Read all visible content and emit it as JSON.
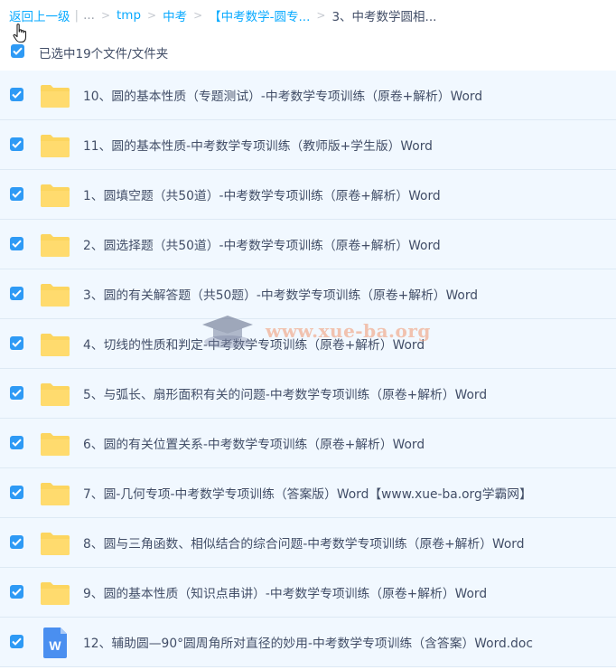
{
  "breadcrumb": {
    "back": "返回上一级",
    "ellipsis": "...",
    "items": [
      "tmp",
      "中考",
      "【中考数学-圆专...",
      "3、中考数学圆相..."
    ]
  },
  "selection": {
    "text": "已选中19个文件/文件夹",
    "checked": true
  },
  "files": [
    {
      "name": "10、圆的基本性质（专题测试）-中考数学专项训练（原卷+解析）Word",
      "type": "folder",
      "checked": true
    },
    {
      "name": "11、圆的基本性质-中考数学专项训练（教师版+学生版）Word",
      "type": "folder",
      "checked": true
    },
    {
      "name": "1、圆填空题（共50道）-中考数学专项训练（原卷+解析）Word",
      "type": "folder",
      "checked": true
    },
    {
      "name": "2、圆选择题（共50道）-中考数学专项训练（原卷+解析）Word",
      "type": "folder",
      "checked": true
    },
    {
      "name": "3、圆的有关解答题（共50题）-中考数学专项训练（原卷+解析）Word",
      "type": "folder",
      "checked": true
    },
    {
      "name": "4、切线的性质和判定-中考数学专项训练（原卷+解析）Word",
      "type": "folder",
      "checked": true
    },
    {
      "name": "5、与弧长、扇形面积有关的问题-中考数学专项训练（原卷+解析）Word",
      "type": "folder",
      "checked": true
    },
    {
      "name": "6、圆的有关位置关系-中考数学专项训练（原卷+解析）Word",
      "type": "folder",
      "checked": true
    },
    {
      "name": "7、圆-几何专项-中考数学专项训练（答案版）Word【www.xue-ba.org学霸网】",
      "type": "folder",
      "checked": true
    },
    {
      "name": "8、圆与三角函数、相似结合的综合问题-中考数学专项训练（原卷+解析）Word",
      "type": "folder",
      "checked": true
    },
    {
      "name": "9、圆的基本性质（知识点串讲）-中考数学专项训练（原卷+解析）Word",
      "type": "folder",
      "checked": true
    },
    {
      "name": "12、辅助圆—90°圆周角所对直径的妙用-中考数学专项训练（含答案）Word.doc",
      "type": "word",
      "checked": true
    }
  ],
  "watermark": {
    "text": "www.xue-ba.org"
  },
  "colors": {
    "link": "#09aaff",
    "checkbox": "#2e9af5",
    "folder": "#fcd55f",
    "row_bg": "#f1f8ff",
    "word_icon": "#4a8ff0"
  }
}
